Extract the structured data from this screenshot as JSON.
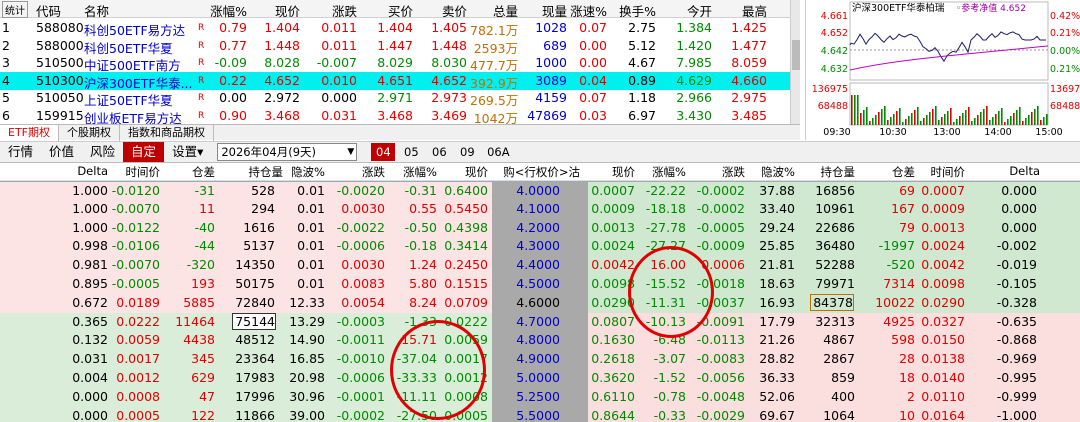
{
  "watchlist": {
    "headers": [
      "统计",
      "代码",
      "名称",
      "涨幅%",
      "现价",
      "涨跌",
      "买价",
      "卖价",
      "总量",
      "现量",
      "涨速%",
      "换手%",
      "今开",
      "最高"
    ],
    "rows": [
      {
        "idx": "1",
        "code": "588080",
        "name": "科创50ETF易方达",
        "flag": "R",
        "chg_pct": "0.79",
        "price": "1.404",
        "chg": "0.011",
        "bid": "1.404",
        "ask": "1.405",
        "vol": "782.1万",
        "cur_vol": "1028",
        "speed": "0.07",
        "turnover": "2.75",
        "open": "1.384",
        "high": "1.425"
      },
      {
        "idx": "2",
        "code": "588000",
        "name": "科创50ETF华夏",
        "flag": "R",
        "chg_pct": "0.77",
        "price": "1.448",
        "chg": "0.011",
        "bid": "1.447",
        "ask": "1.448",
        "vol": "2593万",
        "cur_vol": "689",
        "speed": "0.00",
        "turnover": "5.12",
        "open": "1.420",
        "high": "1.477"
      },
      {
        "idx": "3",
        "code": "510500",
        "name": "中证500ETF南方",
        "flag": "R",
        "chg_pct": "-0.09",
        "price": "8.028",
        "chg": "-0.007",
        "bid": "8.029",
        "ask": "8.030",
        "vol": "477.7万",
        "cur_vol": "1000",
        "speed": "0.00",
        "turnover": "4.67",
        "open": "7.985",
        "high": "8.059"
      },
      {
        "idx": "4",
        "code": "510300",
        "name": "沪深300ETF华泰...",
        "flag": "R",
        "chg_pct": "0.22",
        "price": "4.652",
        "chg": "0.010",
        "bid": "4.651",
        "ask": "4.652",
        "vol": "392.9万",
        "cur_vol": "3089",
        "speed": "0.04",
        "turnover": "0.89",
        "open": "4.629",
        "high": "4.660"
      },
      {
        "idx": "5",
        "code": "510050",
        "name": "上证50ETF华夏",
        "flag": "R",
        "chg_pct": "0.00",
        "price": "2.972",
        "chg": "0.000",
        "bid": "2.971",
        "ask": "2.973",
        "vol": "269.5万",
        "cur_vol": "4159",
        "speed": "0.07",
        "turnover": "1.18",
        "open": "2.966",
        "high": "2.975"
      },
      {
        "idx": "6",
        "code": "159915",
        "name": "创业板ETF易方达",
        "flag": "R",
        "chg_pct": "0.90",
        "price": "3.468",
        "chg": "0.031",
        "bid": "3.468",
        "ask": "3.469",
        "vol": "1042万",
        "cur_vol": "47869",
        "speed": "0.03",
        "turnover": "6.97",
        "open": "3.430",
        "high": "3.485"
      }
    ]
  },
  "bottom_tabs": [
    "ETF期权",
    "个股期权",
    "指数和商品期权"
  ],
  "mini_chart": {
    "title": "沪深300ETF华泰柏瑞",
    "legend_label": "参考净值",
    "legend_value": "4.652",
    "left_ticks": [
      "4.661",
      "4.652",
      "4.642",
      "4.632"
    ],
    "right_ticks": [
      "0.42%",
      "0.21%",
      "0.00%",
      "0.21%"
    ],
    "vol_left": [
      "136975",
      "68488"
    ],
    "vol_right": [
      "13697",
      "68488"
    ],
    "time_labels": [
      "09:30",
      "10:30",
      "13:00",
      "14:00",
      "15:00"
    ]
  },
  "toolbar": {
    "items": [
      "行情",
      "价值",
      "风险",
      "自定",
      "设置▾"
    ],
    "month": "2026年04月(9天)",
    "month_tabs": [
      "04",
      "05",
      "06",
      "09",
      "06A"
    ]
  },
  "options": {
    "headers": [
      "Delta",
      "时间价",
      "仓差",
      "持仓量",
      "隐波%",
      "涨跌",
      "涨幅%",
      "现价",
      "购<行权价>沽",
      "现价",
      "涨幅%",
      "涨跌",
      "隐波%",
      "持仓量",
      "仓差",
      "时间价",
      "Delta"
    ],
    "rows": [
      {
        "c_delta": "1.000",
        "c_tv": "-0.0120",
        "c_oi_chg": "-31",
        "c_oi": "528",
        "c_iv": "0.01",
        "c_chg": "-0.0020",
        "c_pct": "-0.31",
        "c_px": "0.6400",
        "strike": "4.0000",
        "p_px": "0.0007",
        "p_pct": "-22.22",
        "p_chg": "-0.0002",
        "p_iv": "37.88",
        "p_oi": "16856",
        "p_oi_chg": "69",
        "p_tv": "0.0007",
        "p_delta": "0.000"
      },
      {
        "c_delta": "1.000",
        "c_tv": "-0.0070",
        "c_oi_chg": "11",
        "c_oi": "294",
        "c_iv": "0.01",
        "c_chg": "0.0030",
        "c_pct": "0.55",
        "c_px": "0.5450",
        "strike": "4.1000",
        "p_px": "0.0009",
        "p_pct": "-18.18",
        "p_chg": "-0.0002",
        "p_iv": "33.40",
        "p_oi": "10961",
        "p_oi_chg": "167",
        "p_tv": "0.0009",
        "p_delta": "0.000"
      },
      {
        "c_delta": "1.000",
        "c_tv": "-0.0122",
        "c_oi_chg": "-40",
        "c_oi": "1616",
        "c_iv": "0.01",
        "c_chg": "-0.0022",
        "c_pct": "-0.50",
        "c_px": "0.4398",
        "strike": "4.2000",
        "p_px": "0.0013",
        "p_pct": "-27.78",
        "p_chg": "-0.0005",
        "p_iv": "29.24",
        "p_oi": "22686",
        "p_oi_chg": "79",
        "p_tv": "0.0013",
        "p_delta": "0.000"
      },
      {
        "c_delta": "0.998",
        "c_tv": "-0.0106",
        "c_oi_chg": "-44",
        "c_oi": "5137",
        "c_iv": "0.01",
        "c_chg": "-0.0006",
        "c_pct": "-0.18",
        "c_px": "0.3414",
        "strike": "4.3000",
        "p_px": "0.0024",
        "p_pct": "-27.27",
        "p_chg": "-0.0009",
        "p_iv": "25.85",
        "p_oi": "36480",
        "p_oi_chg": "-1997",
        "p_tv": "0.0024",
        "p_delta": "-0.002"
      },
      {
        "c_delta": "0.981",
        "c_tv": "-0.0070",
        "c_oi_chg": "-320",
        "c_oi": "14350",
        "c_iv": "0.01",
        "c_chg": "0.0030",
        "c_pct": "1.24",
        "c_px": "0.2450",
        "strike": "4.4000",
        "p_px": "0.0042",
        "p_pct": "16.00",
        "p_chg": "0.0006",
        "p_iv": "21.81",
        "p_oi": "52288",
        "p_oi_chg": "-520",
        "p_tv": "0.0042",
        "p_delta": "-0.019"
      },
      {
        "c_delta": "0.895",
        "c_tv": "-0.0005",
        "c_oi_chg": "193",
        "c_oi": "50175",
        "c_iv": "0.01",
        "c_chg": "0.0083",
        "c_pct": "5.80",
        "c_px": "0.1515",
        "strike": "4.5000",
        "p_px": "0.0098",
        "p_pct": "-15.52",
        "p_chg": "-0.0018",
        "p_iv": "18.63",
        "p_oi": "79971",
        "p_oi_chg": "7314",
        "p_tv": "0.0098",
        "p_delta": "-0.105"
      },
      {
        "c_delta": "0.672",
        "c_tv": "0.0189",
        "c_oi_chg": "5885",
        "c_oi": "72840",
        "c_iv": "12.33",
        "c_chg": "0.0054",
        "c_pct": "8.24",
        "c_px": "0.0709",
        "strike": "4.6000",
        "p_px": "0.0290",
        "p_pct": "-11.31",
        "p_chg": "-0.0037",
        "p_iv": "16.93",
        "p_oi": "84378",
        "p_oi_chg": "10022",
        "p_tv": "0.0290",
        "p_delta": "-0.328"
      },
      {
        "c_delta": "0.365",
        "c_tv": "0.0222",
        "c_oi_chg": "11464",
        "c_oi": "75144",
        "c_iv": "13.29",
        "c_chg": "-0.0003",
        "c_pct": "-1.33",
        "c_px": "0.0222",
        "strike": "4.7000",
        "p_px": "0.0807",
        "p_pct": "-10.13",
        "p_chg": "-0.0091",
        "p_iv": "17.79",
        "p_oi": "32313",
        "p_oi_chg": "4925",
        "p_tv": "0.0327",
        "p_delta": "-0.635"
      },
      {
        "c_delta": "0.132",
        "c_tv": "0.0059",
        "c_oi_chg": "4438",
        "c_oi": "48512",
        "c_iv": "14.90",
        "c_chg": "-0.0011",
        "c_pct": "15.71",
        "c_px": "0.0059",
        "strike": "4.8000",
        "p_px": "0.1630",
        "p_pct": "-6.48",
        "p_chg": "-0.0113",
        "p_iv": "21.26",
        "p_oi": "4867",
        "p_oi_chg": "598",
        "p_tv": "0.0150",
        "p_delta": "-0.868"
      },
      {
        "c_delta": "0.031",
        "c_tv": "0.0017",
        "c_oi_chg": "345",
        "c_oi": "23364",
        "c_iv": "16.85",
        "c_chg": "-0.0010",
        "c_pct": "-37.04",
        "c_px": "0.0017",
        "strike": "4.9000",
        "p_px": "0.2618",
        "p_pct": "-3.07",
        "p_chg": "-0.0083",
        "p_iv": "28.82",
        "p_oi": "2867",
        "p_oi_chg": "28",
        "p_tv": "0.0138",
        "p_delta": "-0.969"
      },
      {
        "c_delta": "0.004",
        "c_tv": "0.0012",
        "c_oi_chg": "629",
        "c_oi": "17983",
        "c_iv": "20.98",
        "c_chg": "-0.0006",
        "c_pct": "-33.33",
        "c_px": "0.0012",
        "strike": "5.0000",
        "p_px": "0.3620",
        "p_pct": "-1.52",
        "p_chg": "-0.0056",
        "p_iv": "36.33",
        "p_oi": "859",
        "p_oi_chg": "18",
        "p_tv": "0.0140",
        "p_delta": "-0.995"
      },
      {
        "c_delta": "0.000",
        "c_tv": "0.0008",
        "c_oi_chg": "47",
        "c_oi": "17996",
        "c_iv": "30.96",
        "c_chg": "-0.0001",
        "c_pct": "-11.11",
        "c_px": "0.0008",
        "strike": "5.2500",
        "p_px": "0.6110",
        "p_pct": "-0.78",
        "p_chg": "-0.0048",
        "p_iv": "52.06",
        "p_oi": "400",
        "p_oi_chg": "2",
        "p_tv": "0.0110",
        "p_delta": "-0.999"
      },
      {
        "c_delta": "0.000",
        "c_tv": "0.0005",
        "c_oi_chg": "122",
        "c_oi": "11866",
        "c_iv": "39.00",
        "c_chg": "-0.0002",
        "c_pct": "-27.50",
        "c_px": "0.0005",
        "strike": "5.5000",
        "p_px": "0.8644",
        "p_pct": "-0.33",
        "p_chg": "-0.0029",
        "p_iv": "69.67",
        "p_oi": "1064",
        "p_oi_chg": "10",
        "p_tv": "0.0164",
        "p_delta": "-1.000"
      }
    ]
  },
  "colors": {
    "up": "#e00000",
    "down": "#008a00",
    "call_itm_bg": "#fce4e4",
    "put_itm_bg": "#cfe8cf",
    "call_otm_bg": "#d9edd9",
    "put_otm_bg": "#fbdede",
    "strike_bg": "#a9a9a9",
    "annotation": "#e00000",
    "selected_row": "#00f0f0"
  }
}
